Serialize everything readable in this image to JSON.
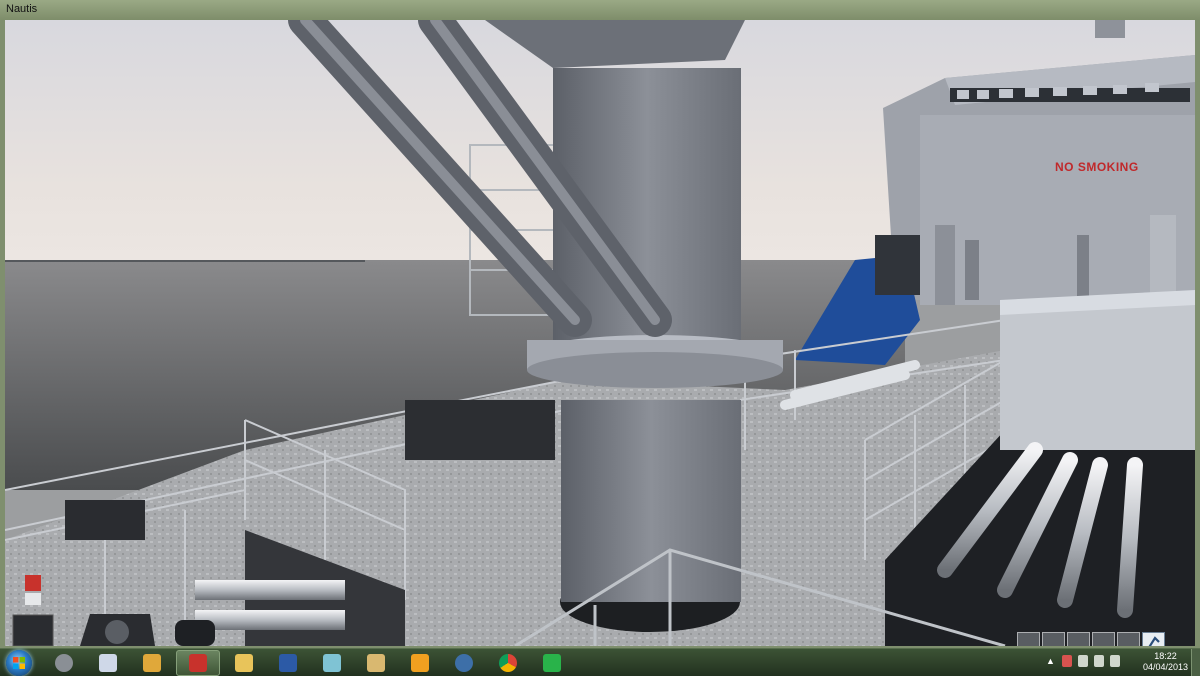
{
  "window": {
    "title": "Nautis"
  },
  "scene": {
    "ship_signage": "NO SMOKING"
  },
  "hud": {
    "view_buttons": [
      "view-1",
      "view-2",
      "view-3",
      "view-4",
      "view-5",
      "view-6"
    ],
    "tool_icon": "crane-tool-icon"
  },
  "taskbar": {
    "apps": [
      {
        "name": "settings-app",
        "color": "#8a8f95"
      },
      {
        "name": "calculator-app",
        "color": "#cfd8e8"
      },
      {
        "name": "simulation-app",
        "color": "#e0a83a"
      },
      {
        "name": "nautis-app",
        "color": "#c8322c",
        "active": true
      },
      {
        "name": "explorer-app",
        "color": "#e8c45a"
      },
      {
        "name": "word-app",
        "color": "#2c5aa6"
      },
      {
        "name": "notes-app",
        "color": "#7fc3d4"
      },
      {
        "name": "package-app",
        "color": "#d9b870"
      },
      {
        "name": "xmind-app",
        "color": "#f0a020"
      },
      {
        "name": "thunderbird-app",
        "color": "#3d6fa8"
      },
      {
        "name": "chrome-app",
        "color": "#4caf50"
      },
      {
        "name": "media-app",
        "color": "#29b34a"
      }
    ],
    "clock": {
      "time": "18:22",
      "date": "04/04/2013"
    }
  }
}
